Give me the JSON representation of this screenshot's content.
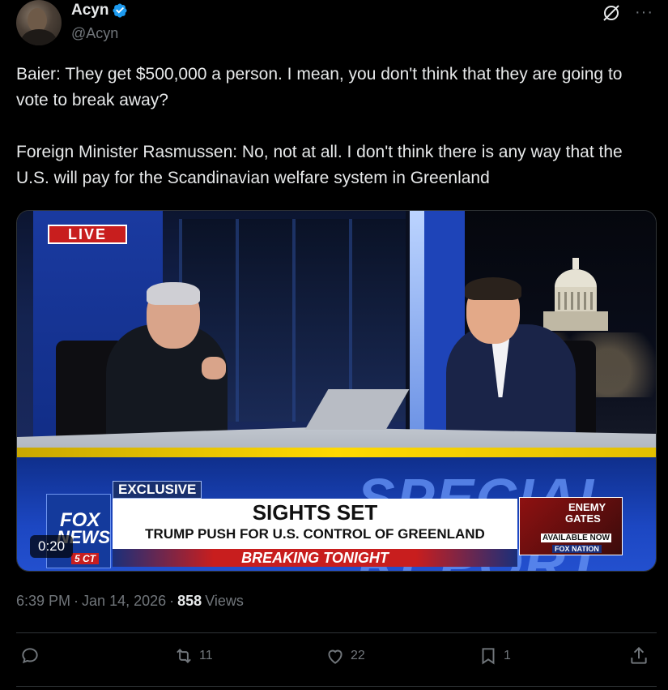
{
  "author": {
    "name": "Acyn",
    "handle": "@Acyn",
    "verified": true
  },
  "tweet": {
    "paragraph1": "Baier: They get $500,000 a person. I mean, you don't think that they are going to vote to break away?",
    "paragraph2": "Foreign Minister Rasmussen: No, not at all. I don't think there is any way that the U.S. will pay for the Scandinavian welfare system in Greenland"
  },
  "video": {
    "live_label": "LIVE",
    "exclusive_label": "EXCLUSIVE",
    "headline": "SIGHTS SET",
    "subheadline": "TRUMP PUSH FOR U.S. CONTROL OF GREENLAND",
    "breaking": "BREAKING TONIGHT",
    "network_line1": "FOX",
    "network_line2": "NEWS",
    "network_time": "5 CT",
    "background_text": "SPECIAL REPORT",
    "ad_line1": "ENEMY",
    "ad_line2": "GATES",
    "ad_line3": "AVAILABLE NOW",
    "ad_line4": "FOX NATION",
    "elapsed": "0:20"
  },
  "meta": {
    "time": "6:39 PM",
    "separator": "·",
    "date": "Jan 14, 2026",
    "views_count": "858",
    "views_label": "Views"
  },
  "actions": {
    "replies": "",
    "reposts": "11",
    "likes": "22",
    "bookmarks": "1"
  },
  "colors": {
    "background": "#000000",
    "text": "#e7e9ea",
    "muted": "#71767b",
    "verified": "#1d9bf0",
    "border": "#2f3336"
  },
  "icons": [
    "verified-badge-icon",
    "grok-icon",
    "more-icon",
    "reply-icon",
    "repost-icon",
    "like-icon",
    "bookmark-icon",
    "share-icon"
  ]
}
